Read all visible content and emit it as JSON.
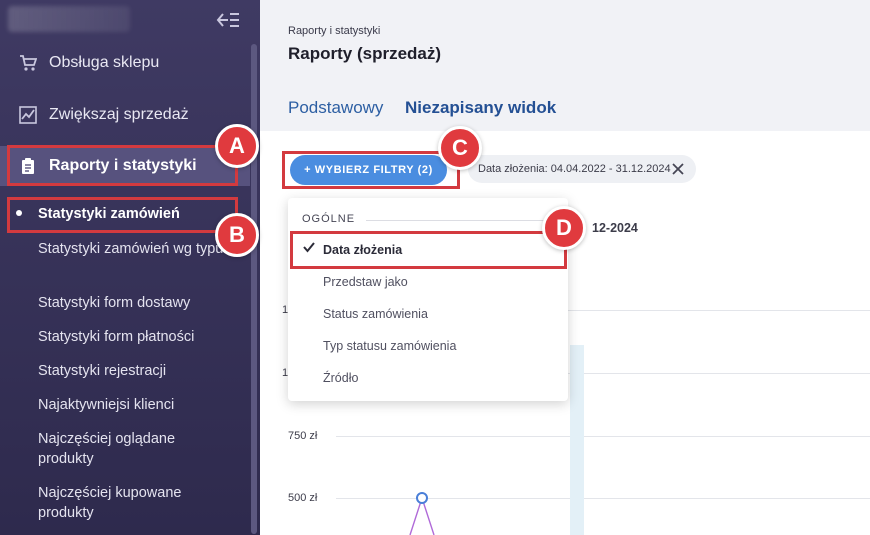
{
  "sidebar": {
    "nav": [
      {
        "label": "Obsługa sklepu",
        "icon": "cart-icon"
      },
      {
        "label": "Zwiększaj sprzedaż",
        "icon": "chart-icon"
      },
      {
        "label": "Raporty i statystyki",
        "icon": "clipboard-icon",
        "active": true
      }
    ],
    "sub": [
      {
        "label": "Statystyki zamówień",
        "active": true
      },
      {
        "label": "Statystyki zamówień wg typu"
      },
      {
        "label": "Statystyki form dostawy"
      },
      {
        "label": "Statystyki form płatności"
      },
      {
        "label": "Statystyki rejestracji"
      },
      {
        "label": "Najaktywniejsi klienci"
      },
      {
        "label": "Najczęściej oglądane produkty"
      },
      {
        "label": "Najczęściej kupowane produkty"
      }
    ]
  },
  "header": {
    "breadcrumb": "Raporty i statystyki",
    "title": "Raporty (sprzedaż)",
    "tabs": [
      "Podstawowy",
      "Niezapisany widok"
    ]
  },
  "toolbar": {
    "filters_button": "+ WYBIERZ FILTRY (2)",
    "chip": "Data złożenia: 04.04.2022 - 31.12.2024"
  },
  "chart": {
    "date_range_partial": "12-2024",
    "y_ticks": [
      "750 zł",
      "500 zł"
    ],
    "y_ticks_partial": [
      "1",
      "1"
    ]
  },
  "dropdown": {
    "section": "OGÓLNE",
    "items": [
      {
        "label": "Data złożenia",
        "checked": true
      },
      {
        "label": "Przedstaw jako"
      },
      {
        "label": "Status zamówienia"
      },
      {
        "label": "Typ statusu zamówienia"
      },
      {
        "label": "Źródło"
      }
    ]
  },
  "annotations": [
    "A",
    "B",
    "C",
    "D"
  ],
  "colors": {
    "sidebar": "#3f3a63",
    "accent": "#4a8de0",
    "annotation": "#e03a3e"
  }
}
